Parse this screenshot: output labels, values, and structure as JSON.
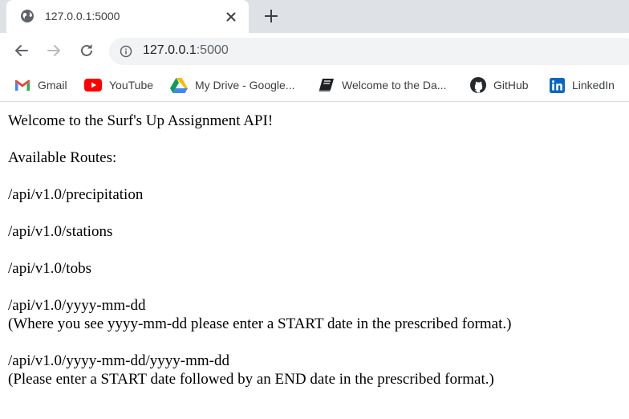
{
  "browser": {
    "tab": {
      "title": "127.0.0.1:5000"
    },
    "address": {
      "host": "127.0.0.1",
      "port_suffix": ":5000"
    },
    "bookmarks": [
      {
        "label": "Gmail"
      },
      {
        "label": "YouTube"
      },
      {
        "label": "My Drive - Google..."
      },
      {
        "label": "Welcome to the Da..."
      },
      {
        "label": "GitHub"
      },
      {
        "label": "LinkedIn"
      }
    ]
  },
  "page": {
    "welcome": "Welcome to the Surf's Up Assignment API!",
    "routes_heading": "Available Routes:",
    "routes": [
      "/api/v1.0/precipitation",
      "/api/v1.0/stations",
      "/api/v1.0/tobs",
      "/api/v1.0/yyyy-mm-dd",
      "/api/v1.0/yyyy-mm-dd/yyyy-mm-dd"
    ],
    "notes": [
      "(Where you see yyyy-mm-dd please enter a START date in the prescribed format.)",
      "(Please enter a START date followed by an END date in the prescribed format.)"
    ]
  },
  "icons": {
    "tab_favicon": "globe-icon",
    "tab_close": "close-icon",
    "new_tab": "plus-icon",
    "back": "arrow-left-icon",
    "forward": "arrow-right-icon",
    "reload": "reload-icon",
    "site_info": "info-icon"
  },
  "colors": {
    "tabstrip": "#dee1e6",
    "omnibox": "#f1f3f4",
    "gmail_red": "#ea4335",
    "youtube_red": "#ff0000",
    "linkedin_blue": "#0a66c2"
  }
}
